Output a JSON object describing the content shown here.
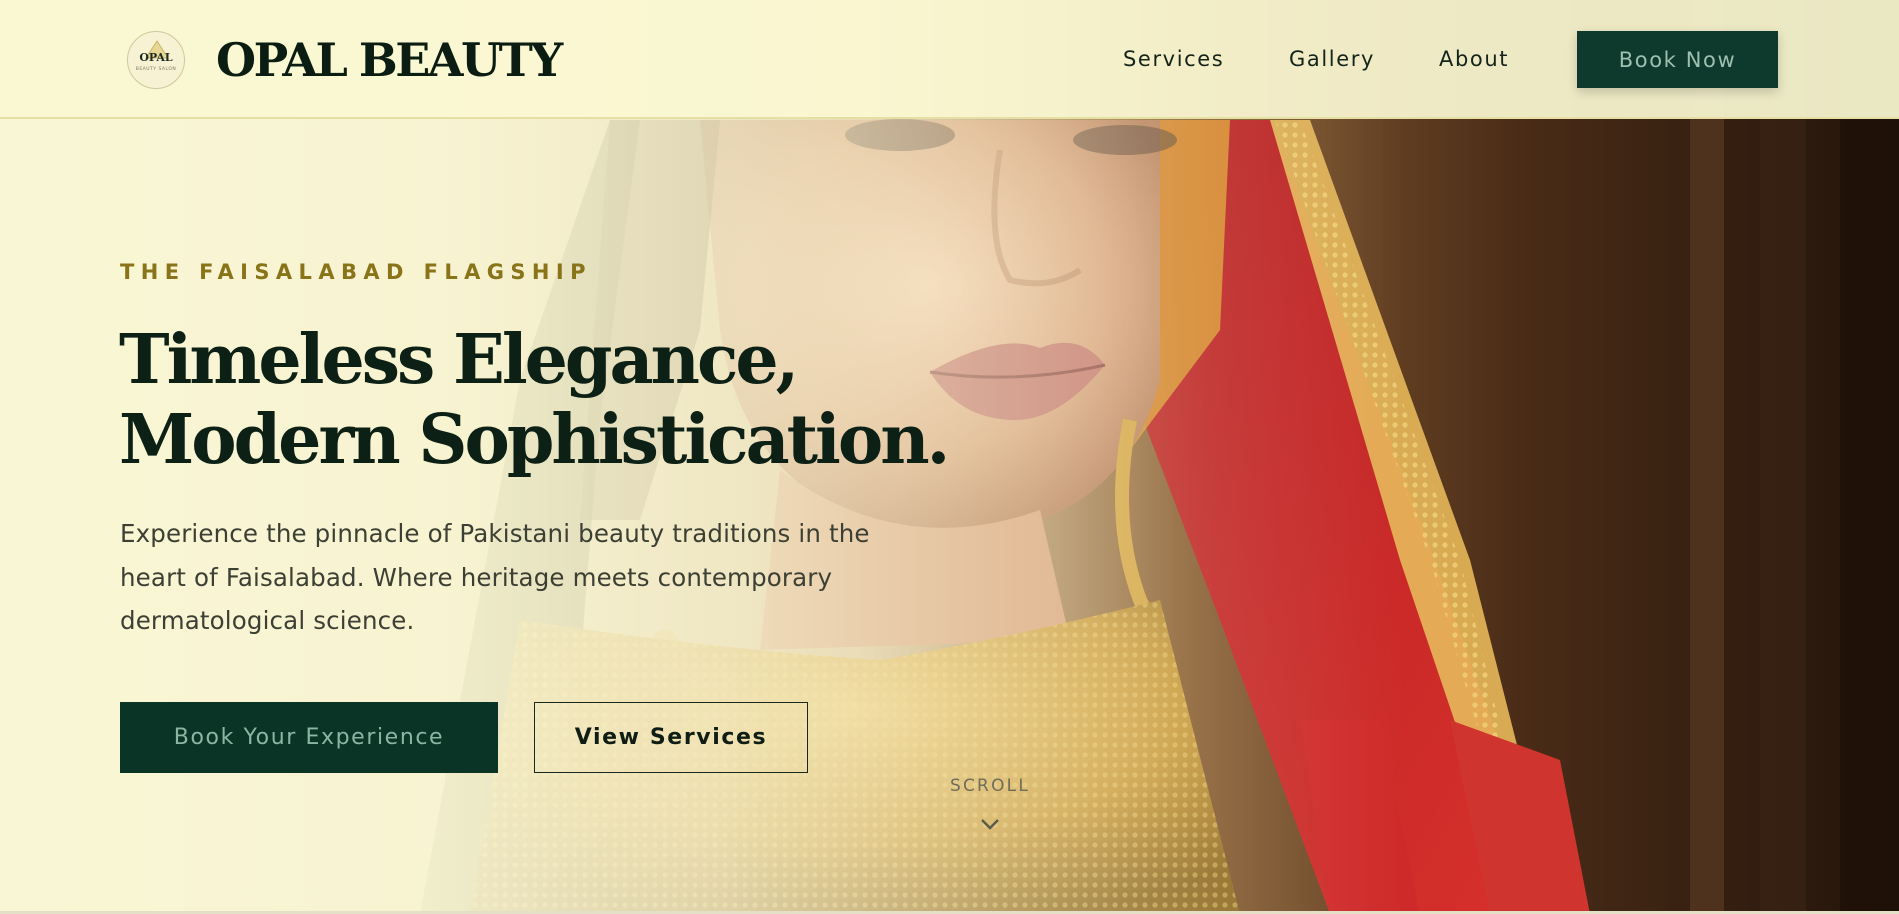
{
  "header": {
    "logo_badge": {
      "name": "OPAL",
      "subtitle": "BEAUTY SALON"
    },
    "brand": "OPAL BEAUTY",
    "nav": [
      {
        "label": "Services"
      },
      {
        "label": "Gallery"
      },
      {
        "label": "About"
      }
    ],
    "cta_label": "Book Now"
  },
  "hero": {
    "eyebrow": "THE FAISALABAD FLAGSHIP",
    "headline_lines": [
      "Timeless Elegance,",
      "Modern Sophistication."
    ],
    "lede": "Experience the pinnacle of Pakistani beauty traditions in the heart of Faisalabad. Where heritage meets contemporary dermatological science.",
    "primary_cta": "Book Your Experience",
    "secondary_cta": "View Services",
    "scroll_label": "SCROLL",
    "scroll_icon": "chevron-down-icon",
    "background_image": "bride-portrait-image"
  },
  "colors": {
    "accent_green": "#0d3a2c",
    "eyebrow_gold": "#8a7419",
    "header_cream": "#faf7d2",
    "heading_ink": "#0c2016"
  }
}
